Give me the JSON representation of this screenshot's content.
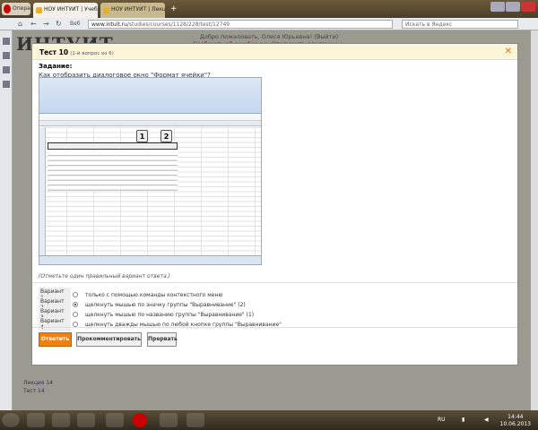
{
  "browser": {
    "opera_label": "Опера",
    "tabs": [
      {
        "label": "НОУ ИНТУИТ | Учебн..."
      },
      {
        "label": "НОУ ИНТУИТ | Лекци..."
      }
    ],
    "url_domain": "www.intuit.ru",
    "url_path": "/studies/courses/1128/228/test/12749",
    "url_prefix": "Веб",
    "search_placeholder": "Искать в Яндекс"
  },
  "site": {
    "logo": "ИНТУИТ",
    "welcome": "Добро пожаловать, Олеся Юрьевна! (Выйти)",
    "links": "Сообщить об ошибке >>  Отключить рекламу >>",
    "left_items": [
      "Лекция 14",
      "Тест 14"
    ]
  },
  "modal": {
    "title": "Тест 10",
    "subtitle": "(1-й вопрос из 6)",
    "task_label": "Задание:",
    "question": "Как отобразить диалоговое окно \"Формат ячейки\"?",
    "callouts": [
      "1",
      "2"
    ],
    "hint": "(Отметьте один правильный вариант ответа.)",
    "variants": [
      {
        "label": "Вариант 1",
        "text": "только с помощью команды контекстного меню",
        "selected": false
      },
      {
        "label": "Вариант 2",
        "text": "щелкнуть мышью по значку группы \"Выравнивание\" (2)",
        "selected": true
      },
      {
        "label": "Вариант 3",
        "text": "щелкнуть мышью по названию группы \"Выравнивание\" (1)",
        "selected": false
      },
      {
        "label": "Вариант 4",
        "text": "щелкнуть дважды мышью по любой кнопке группы \"Выравнивание\"",
        "selected": false
      }
    ],
    "buttons": {
      "answer": "Ответить",
      "comment": "Прокомментировать",
      "abort": "Прервать"
    }
  },
  "taskbar": {
    "lang": "RU",
    "time": "14:44",
    "date": "10.06.2013"
  },
  "colors": {
    "accent": "#f08010"
  }
}
